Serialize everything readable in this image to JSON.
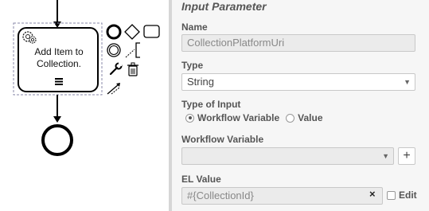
{
  "canvas": {
    "task_label_line1": "Add Item to",
    "task_label_line2": "Collection.",
    "palette": [
      "end-event",
      "gateway",
      "task",
      "intermediate-event",
      "text-annotation",
      "change-type-wrench",
      "delete-trash",
      "connect-arrow"
    ]
  },
  "panel": {
    "title": "Input Parameter",
    "name_label": "Name",
    "name_value": "CollectionPlatformUri",
    "type_label": "Type",
    "type_value": "String",
    "input_type_label": "Type of Input",
    "radio_workflow_variable": "Workflow Variable",
    "radio_value": "Value",
    "selected_input_type": "Workflow Variable",
    "workflow_variable_label": "Workflow Variable",
    "workflow_variable_value": "",
    "add_button": "+",
    "el_value_label": "EL Value",
    "el_value": "#{CollectionId}",
    "clear_symbol": "×",
    "edit_label": "Edit"
  }
}
